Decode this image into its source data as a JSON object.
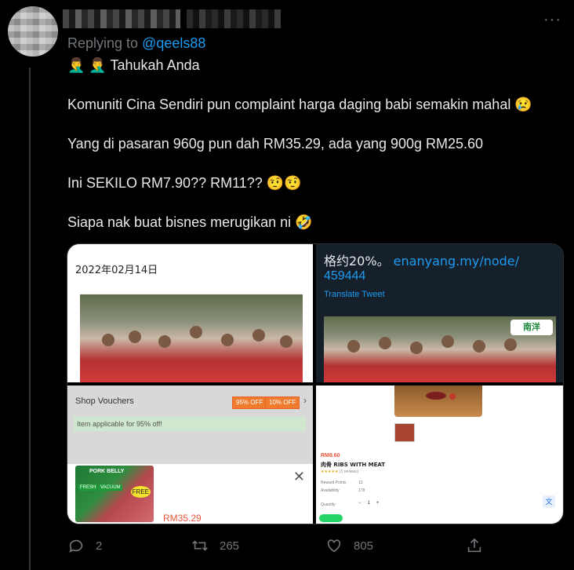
{
  "reply": {
    "prefix": "Replying to",
    "handle": "@qeels88"
  },
  "tweet": {
    "line1_emoji": "🤦‍♂️ 🤦‍♂️",
    "line1_text": "Tahukah Anda",
    "line2": "Komuniti Cina Sendiri pun complaint harga daging babi semakin mahal",
    "line2_emoji": "😢",
    "line3": "Yang di pasaran 960g pun dah RM35.29, ada yang 900g RM25.60",
    "line4": "Ini SEKILO RM7.90?? RM11??",
    "line4_emoji": "🤨🤨",
    "line5": "Siapa nak buat bisnes merugikan ni",
    "line5_emoji": "🤣"
  },
  "media": {
    "img1": {
      "date": "2022年02月14日"
    },
    "img2": {
      "text": "格约20%。",
      "link_line1": "enanyang.my/node/",
      "link_line2": "459444",
      "translate": "Translate Tweet",
      "logo": "南洋"
    },
    "img3": {
      "title": "Shop Vouchers",
      "badge1": "95% OFF",
      "badge2": "10% OFF",
      "note": "Item applicable for 95% off!",
      "product": "PORK BELLY",
      "tag1": "FRESH",
      "tag2": "VACUUM",
      "tag3": "FREE",
      "price": "RM35.29"
    },
    "img4": {
      "price": "RM8.60",
      "title": "肉骨 RIBS WITH MEAT",
      "reviews": "(1 reviews)",
      "row1_label": "Reward Points",
      "row1_val": "13",
      "row2_label": "Availability",
      "row2_val": "178",
      "qty_label": "Quantity",
      "qty_minus": "−",
      "qty_val": "1",
      "qty_plus": "+"
    }
  },
  "actions": {
    "replies": "2",
    "retweets": "265",
    "likes": "805"
  },
  "colors": {
    "accent": "#1d9bf0",
    "muted": "#71767b",
    "text": "#e7e9ea"
  }
}
